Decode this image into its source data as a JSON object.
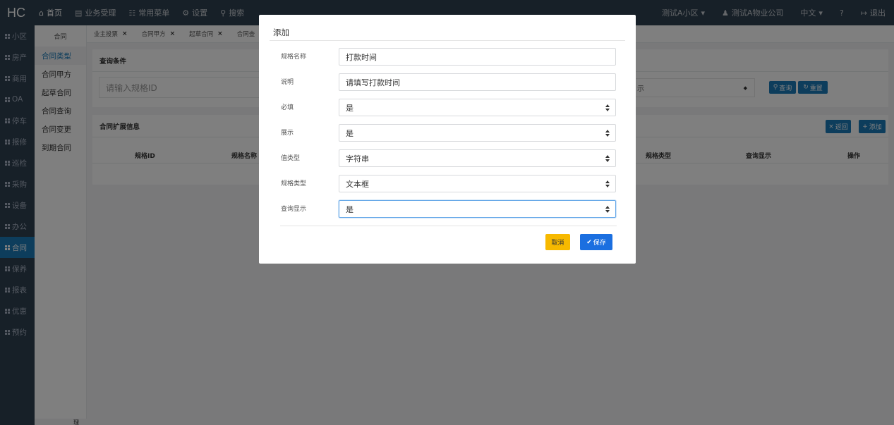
{
  "brand": "HC",
  "topnav": [
    {
      "label": "首页",
      "icon": "home-icon"
    },
    {
      "label": "业务受理",
      "icon": "list-icon"
    },
    {
      "label": "常用菜单",
      "icon": "sitemap-icon"
    },
    {
      "label": "设置",
      "icon": "gear-icon"
    },
    {
      "label": "搜索",
      "icon": "search-icon"
    }
  ],
  "topright": {
    "community": "测试A小区",
    "company": "测试A物业公司",
    "language": "中文",
    "logout": "退出"
  },
  "sidebar": [
    "小区",
    "房产",
    "商用",
    "OA",
    "停车",
    "报修",
    "巡检",
    "采购",
    "设备",
    "办公",
    "合同",
    "保养",
    "报表",
    "优惠",
    "预约"
  ],
  "subside": {
    "header": "合同",
    "items": [
      "合同类型",
      "合同甲方",
      "起草合同",
      "合同查询",
      "合同变更",
      "到期合同"
    ],
    "bottom": "理"
  },
  "tabs": [
    "业主投票",
    "合同甲方",
    "起草合同",
    "合同查"
  ],
  "query_panel": {
    "title": "查询条件",
    "input_placeholder": "请输入规格ID",
    "select_value": "示",
    "search_button": "查询",
    "reset_button": "重置"
  },
  "ext_panel": {
    "title": "合同扩展信息",
    "back_button": "返回",
    "add_button": "添加",
    "columns": [
      "规格ID",
      "规格名称",
      "规格类型",
      "查询显示",
      "操作"
    ]
  },
  "modal": {
    "title": "添加",
    "rows": [
      {
        "label": "规格名称",
        "value": "打款时间",
        "type": "input"
      },
      {
        "label": "说明",
        "value": "请填写打款时间",
        "type": "input"
      },
      {
        "label": "必填",
        "value": "是",
        "type": "select"
      },
      {
        "label": "展示",
        "value": "是",
        "type": "select"
      },
      {
        "label": "值类型",
        "value": "字符串",
        "type": "select"
      },
      {
        "label": "规格类型",
        "value": "文本框",
        "type": "select"
      },
      {
        "label": "查询显示",
        "value": "是",
        "type": "select"
      }
    ],
    "cancel": "取消",
    "save": "保存"
  },
  "colors": {
    "sidebar": "#2f4050",
    "primary": "#1a7bb9",
    "save": "#1b6fe0",
    "cancel": "#f7b900"
  }
}
